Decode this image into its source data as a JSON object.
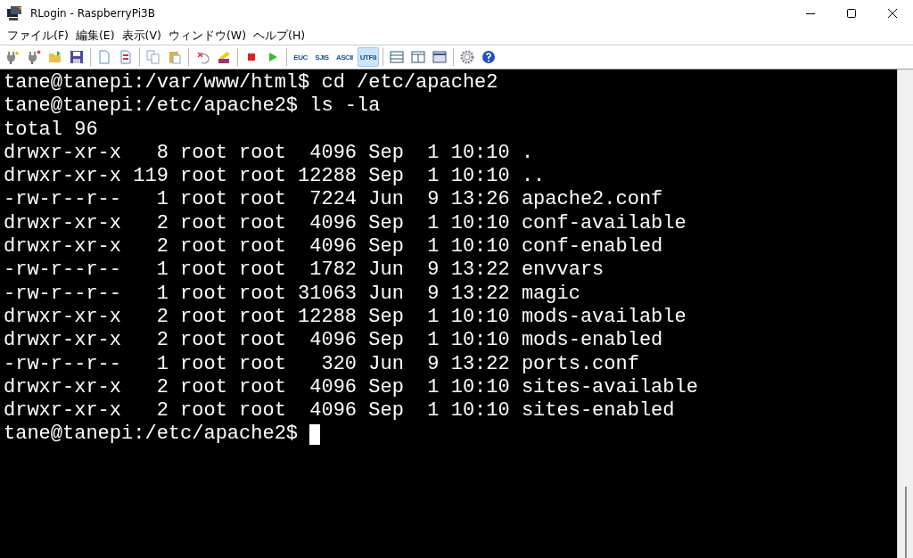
{
  "window": {
    "title": "RLogin - RaspberryPi3B"
  },
  "menu": [
    {
      "label": "ファイル(F)"
    },
    {
      "label": "編集(E)"
    },
    {
      "label": "表示(V)"
    },
    {
      "label": "ウィンドウ(W)"
    },
    {
      "label": "ヘルプ(H)"
    }
  ],
  "toolbar": {
    "encodings": [
      {
        "label": "EUC",
        "selected": false
      },
      {
        "label": "SJIS",
        "selected": false
      },
      {
        "label": "ASCII",
        "selected": false
      },
      {
        "label": "UTF8",
        "selected": true
      }
    ]
  },
  "terminal": {
    "lines": [
      "tane@tanepi:/var/www/html$ cd /etc/apache2",
      "tane@tanepi:/etc/apache2$ ls -la",
      "total 96",
      "drwxr-xr-x   8 root root  4096 Sep  1 10:10 .",
      "drwxr-xr-x 119 root root 12288 Sep  1 10:10 ..",
      "-rw-r--r--   1 root root  7224 Jun  9 13:26 apache2.conf",
      "drwxr-xr-x   2 root root  4096 Sep  1 10:10 conf-available",
      "drwxr-xr-x   2 root root  4096 Sep  1 10:10 conf-enabled",
      "-rw-r--r--   1 root root  1782 Jun  9 13:22 envvars",
      "-rw-r--r--   1 root root 31063 Jun  9 13:22 magic",
      "drwxr-xr-x   2 root root 12288 Sep  1 10:10 mods-available",
      "drwxr-xr-x   2 root root  4096 Sep  1 10:10 mods-enabled",
      "-rw-r--r--   1 root root   320 Jun  9 13:22 ports.conf",
      "drwxr-xr-x   2 root root  4096 Sep  1 10:10 sites-available",
      "drwxr-xr-x   2 root root  4096 Sep  1 10:10 sites-enabled"
    ],
    "prompt": "tane@tanepi:/etc/apache2$"
  }
}
